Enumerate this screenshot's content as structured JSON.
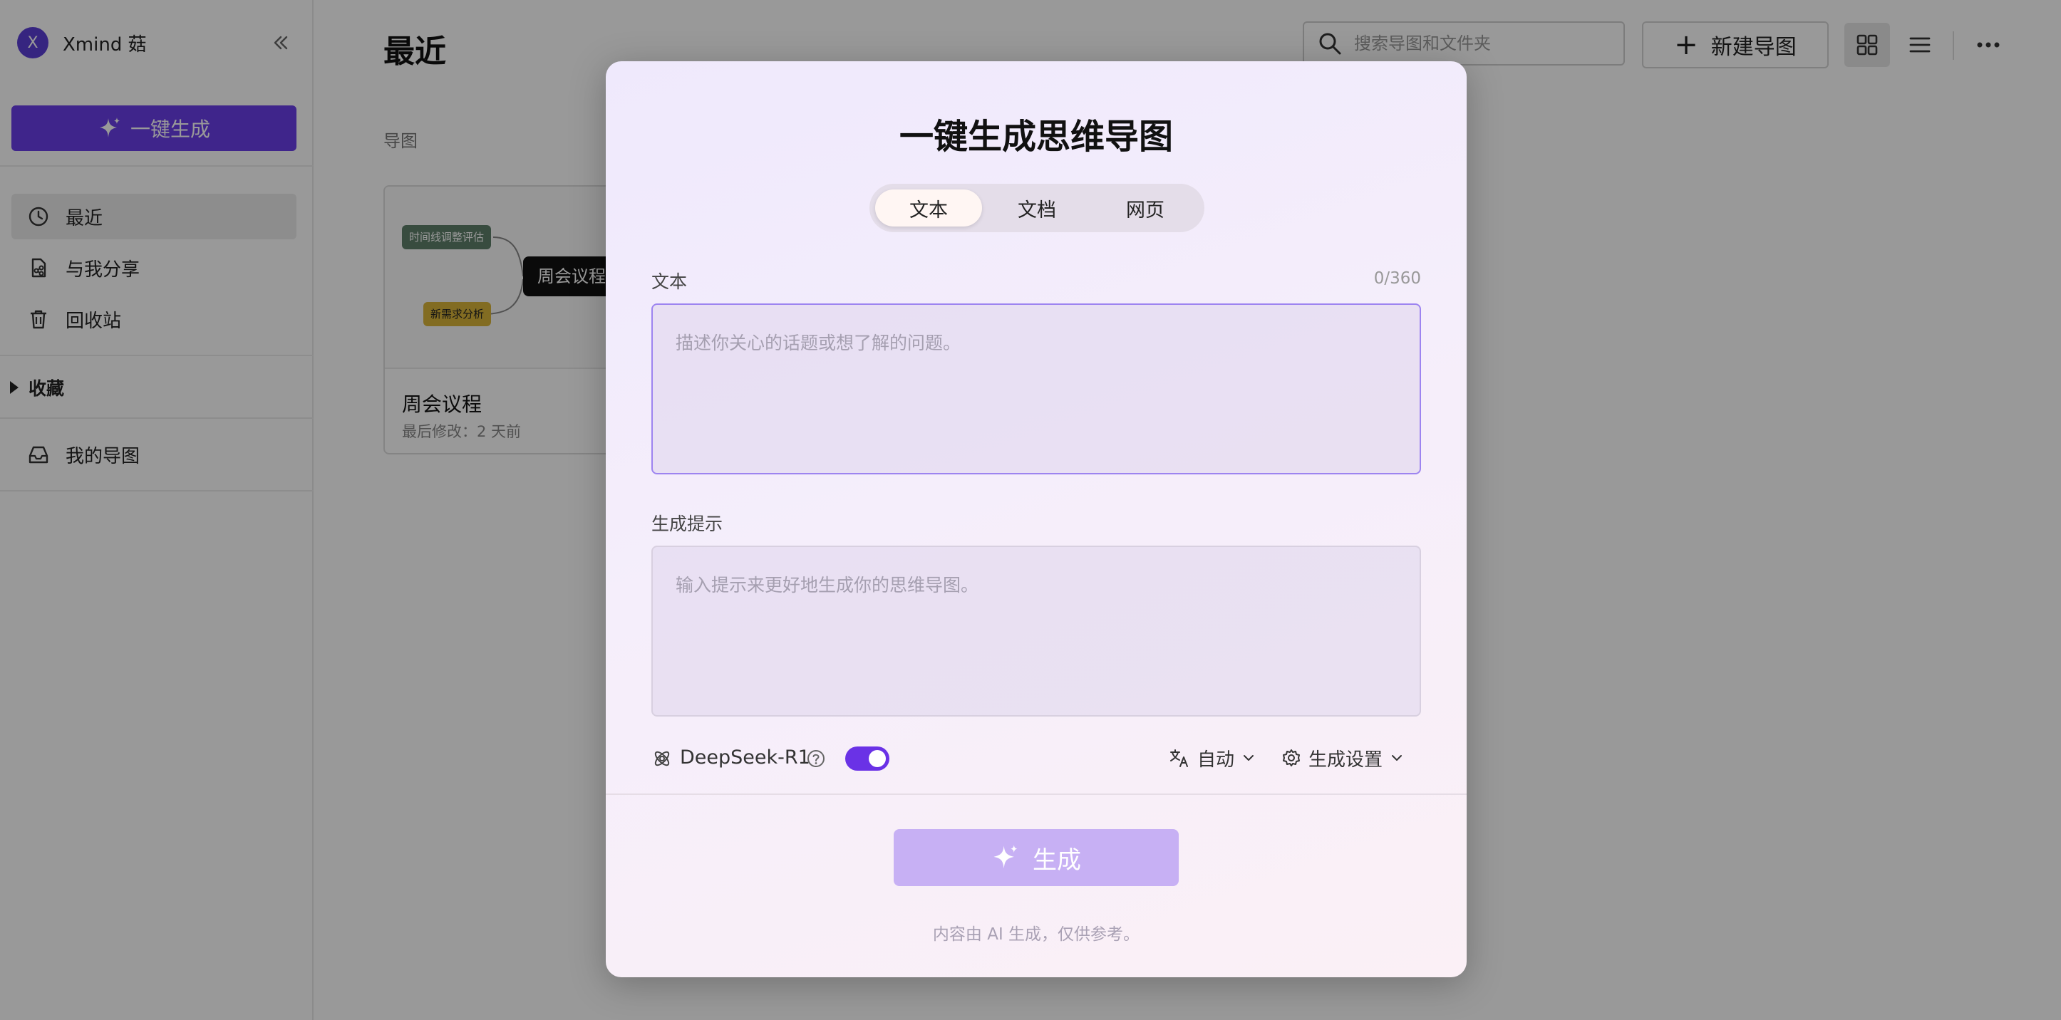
{
  "sidebar": {
    "account_initial": "X",
    "account_name": "Xmind 菇",
    "generate_label": "一键生成",
    "nav": [
      {
        "label": "最近",
        "icon": "clock-icon"
      },
      {
        "label": "与我分享",
        "icon": "shared-file-icon"
      },
      {
        "label": "回收站",
        "icon": "trash-icon"
      }
    ],
    "favorites_label": "收藏",
    "my_maps_label": "我的导图"
  },
  "header": {
    "title": "最近",
    "search_placeholder": "搜索导图和文件夹",
    "new_map_label": "新建导图"
  },
  "content": {
    "section_label": "导图",
    "card": {
      "title": "周会议程",
      "meta": "最后修改：2 天前",
      "nodes": {
        "central": "周会议程",
        "branch_a": "时间线调整评估",
        "branch_b": "新需求分析"
      }
    }
  },
  "modal": {
    "title": "一键生成思维导图",
    "tabs": [
      {
        "label": "文本",
        "active": true
      },
      {
        "label": "文档",
        "active": false
      },
      {
        "label": "网页",
        "active": false
      }
    ],
    "text_label": "文本",
    "char_counter": "0/360",
    "text_placeholder": "描述你关心的话题或想了解的问题。",
    "prompt_label": "生成提示",
    "prompt_placeholder": "输入提示来更好地生成你的思维导图。",
    "model_label": "DeepSeek-R1",
    "model_toggle_on": true,
    "language_label": "自动",
    "settings_label": "生成设置",
    "generate_label": "生成",
    "disclaimer": "内容由 AI 生成，仅供参考。"
  },
  "colors": {
    "accent": "#6a3ee8",
    "generate_disabled": "#c7b0f4",
    "overlay": "rgba(0,0,0,0.40)"
  }
}
